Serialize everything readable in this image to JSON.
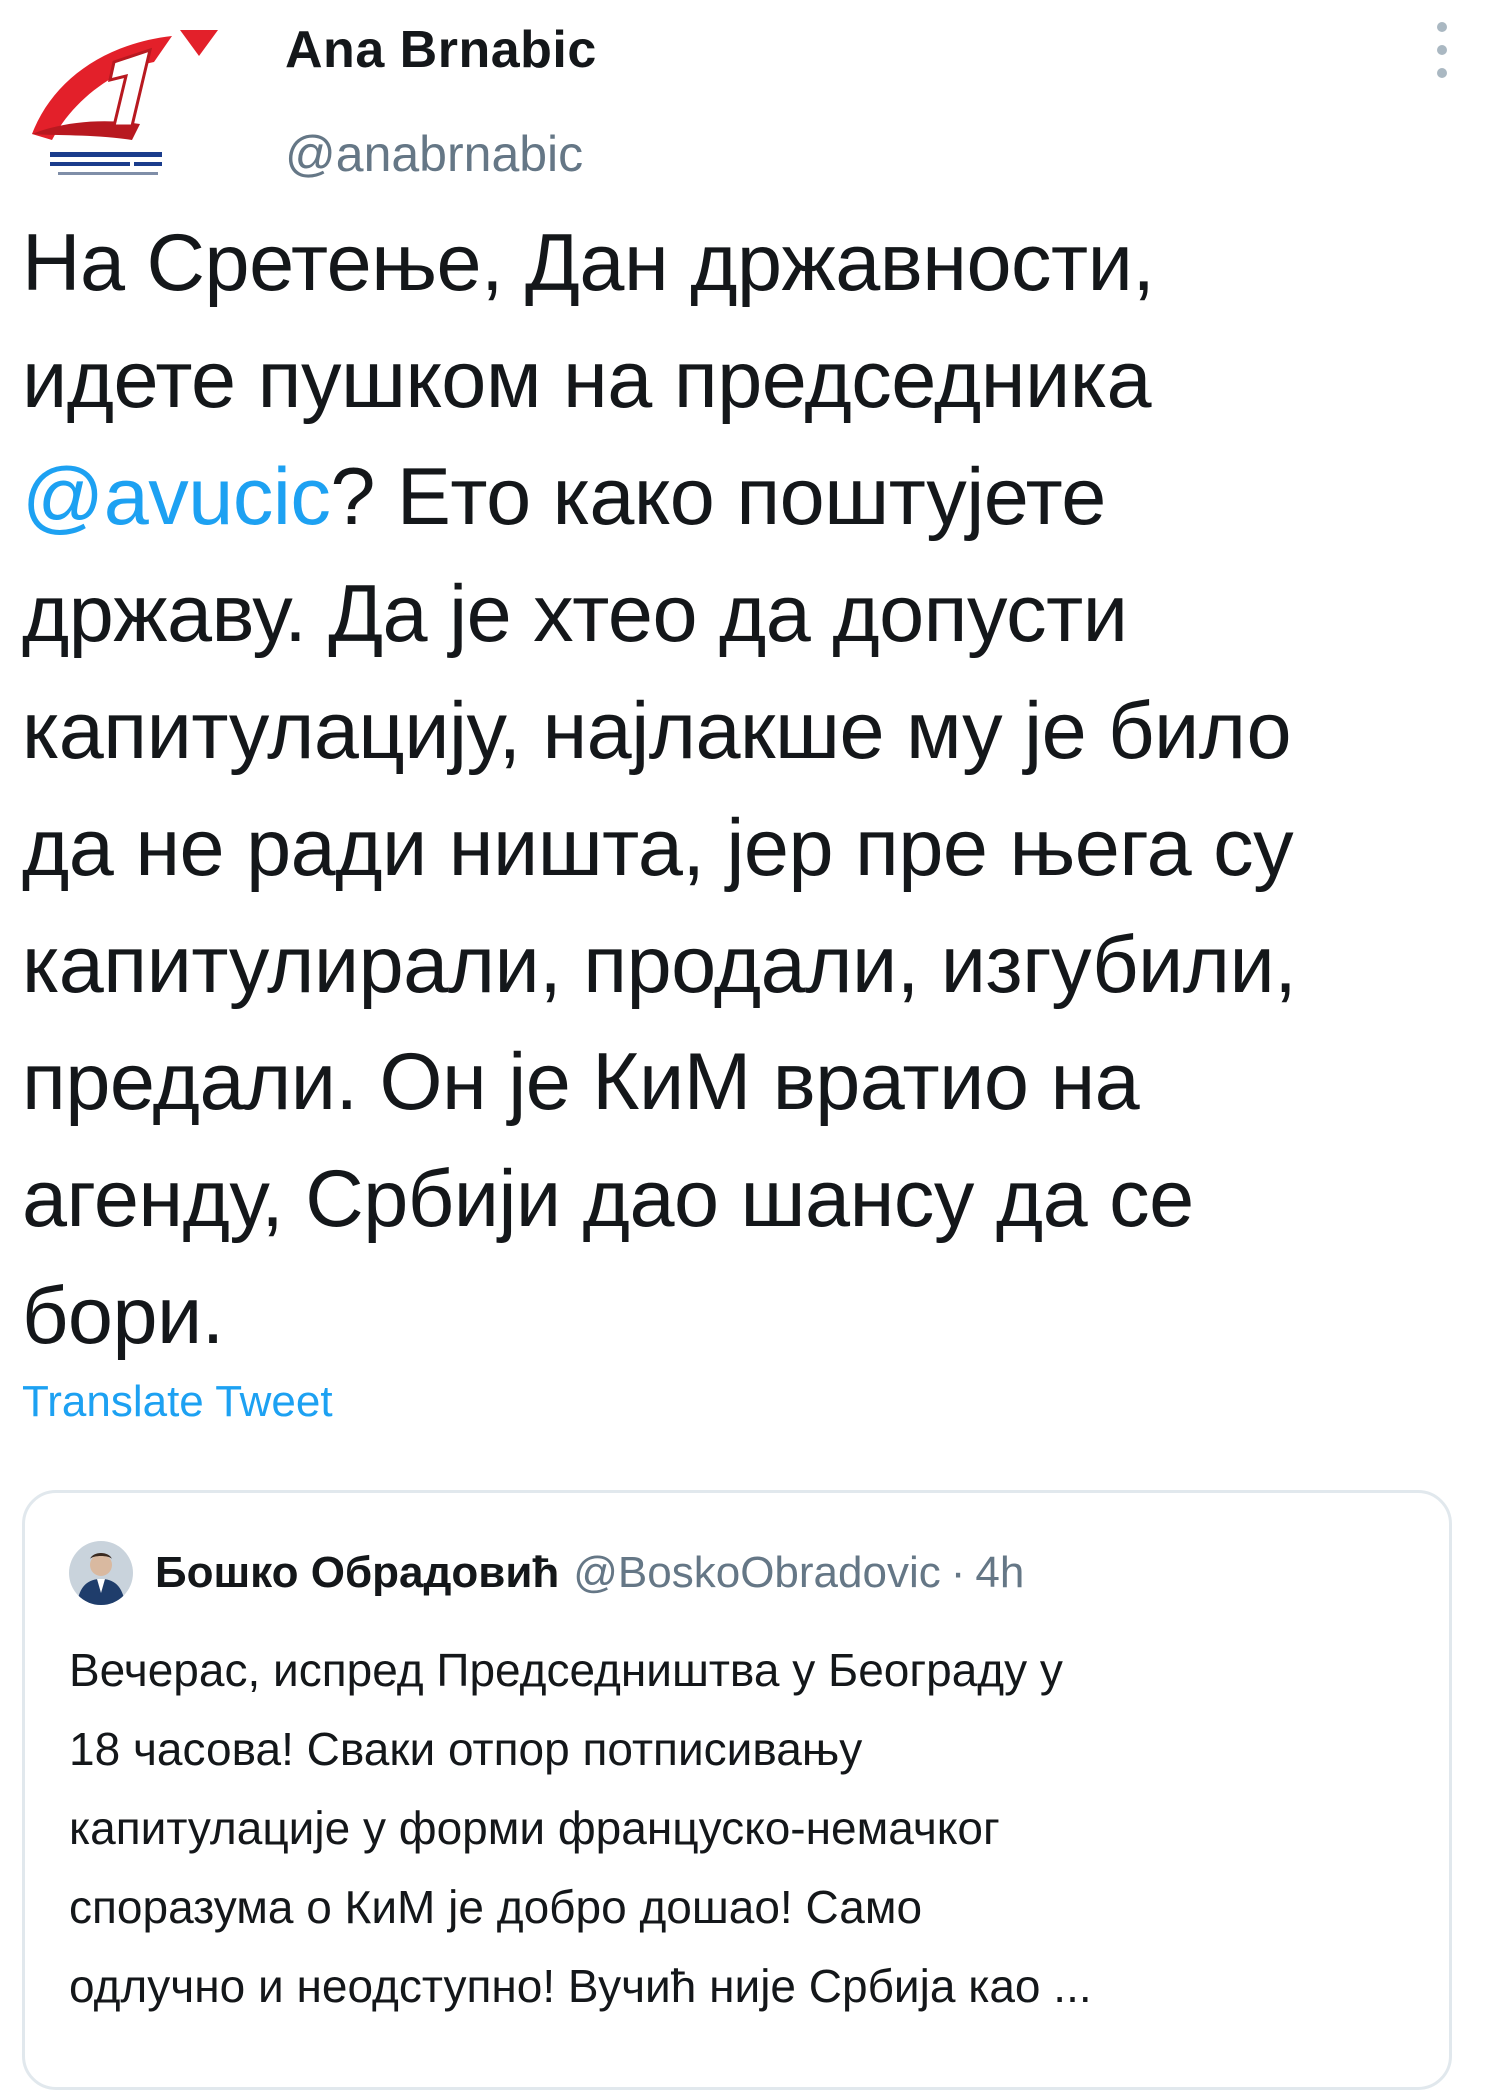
{
  "author": {
    "name": "Ana Brnabic",
    "handle": "@anabrnabic",
    "avatar_icon": "party-logo-avatar"
  },
  "tweet": {
    "lines": [
      "На Сретење, Дан државности,",
      "идете пушком на председника",
      "? Ето како поштујете",
      "државу. Да је хтео да допусти",
      "капитулацију, најлакше му је било",
      "да не ради ништа, јер пре њега су",
      "капитулирали, продали, изгубили,",
      "предали. Он је КиМ вратио на",
      "агенду, Србији дао шансу да се",
      "бори."
    ],
    "mention": "@avucic",
    "translate_label": "Translate Tweet"
  },
  "quoted_tweet": {
    "name": "Бошко Обрадовић",
    "handle": "@BoskoObradovic",
    "separator": "·",
    "time": "4h",
    "lines": [
      "Вечерас, испред Председништва у Београду у",
      "18 часова! Сваки отпор потписивању",
      "капитулације у форми француско-немачког",
      "споразума о КиМ је добро дошао! Само",
      "одлучно и неодступно! Вучић није Србија као ..."
    ]
  },
  "colors": {
    "link": "#1da1f2",
    "text": "#14171a",
    "secondary": "#657786",
    "border": "#e1e8ed",
    "logo_red": "#e3202a"
  }
}
